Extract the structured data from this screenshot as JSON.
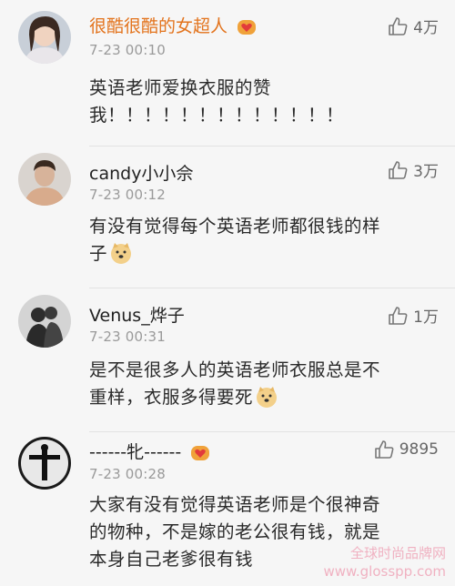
{
  "comments": [
    {
      "username": "很酷很酷的女超人",
      "time": "7-23 00:10",
      "likes": "4万",
      "text_lines": [
        "英语老师爱换衣服的赞",
        "我！！！！！！！！！！！！！"
      ],
      "badge": "heart-badge-icon"
    },
    {
      "username": "candy小小佘",
      "time": "7-23 00:12",
      "likes": "3万",
      "text_lines": [
        "有没有觉得每个英语老师都很钱的样",
        "子"
      ],
      "emoji": "doge-emoji-icon"
    },
    {
      "username": "Venus_烨子",
      "time": "7-23 00:31",
      "likes": "1万",
      "text_lines": [
        "是不是很多人的英语老师衣服总是不",
        "重样，衣服多得要死"
      ],
      "emoji": "doge-emoji-icon"
    },
    {
      "username": "------牝------",
      "time": "7-23 00:28",
      "likes": "9895",
      "text_lines": [
        "大家有没有觉得英语老师是个很神奇",
        "的物种，不是嫁的老公很有钱，就是",
        "本身自己老爹很有钱"
      ],
      "badge": "heart-badge-icon"
    }
  ],
  "watermark": {
    "line1": "全球时尚品牌网",
    "line2": "www.glosspp.com"
  },
  "colors": {
    "vip_name": "#e3731c",
    "timestamp": "#9a9a9a",
    "background": "#f6f6f6"
  }
}
